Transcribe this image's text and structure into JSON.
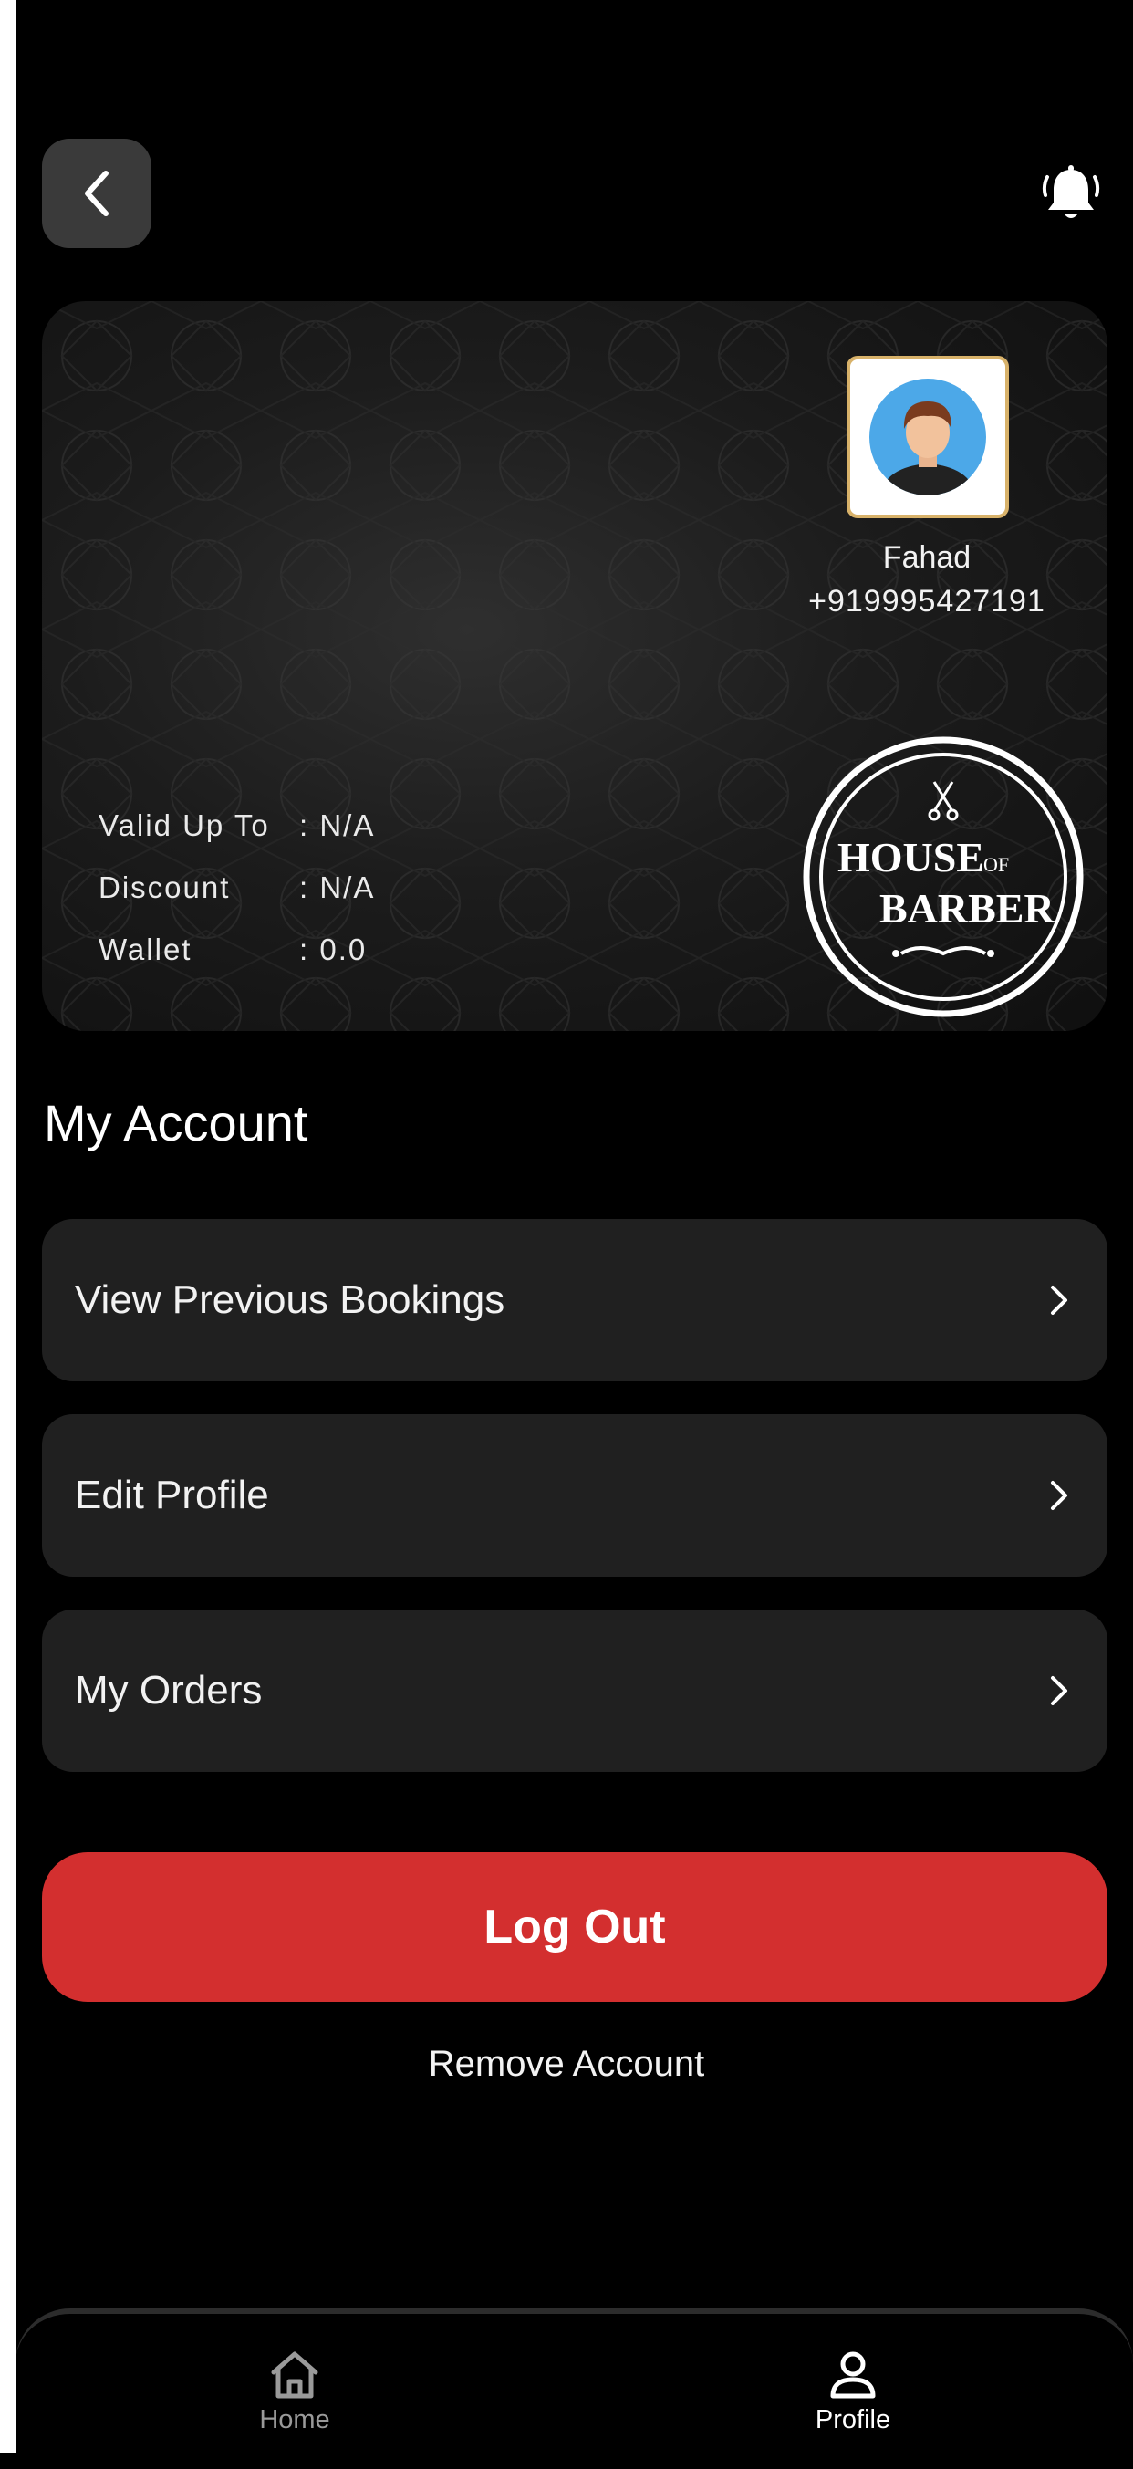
{
  "header": {
    "back_icon": "chevron-left-icon",
    "bell_icon": "bell-ring-icon"
  },
  "profile_card": {
    "name": "Fahad",
    "phone": "+919995427191",
    "avatar_icon": "user-avatar-icon",
    "valid_label": "Valid Up To",
    "valid_value": ": N/A",
    "discount_label": "Discount",
    "discount_value": ": N/A",
    "wallet_label": "Wallet",
    "wallet_value": ": 0.0",
    "logo": {
      "line1": "HOUSE",
      "of": "OF",
      "line2": "BARBER"
    }
  },
  "section_title": "My Account",
  "menu": [
    {
      "label": "View Previous Bookings"
    },
    {
      "label": "Edit Profile"
    },
    {
      "label": "My Orders"
    }
  ],
  "logout_label": "Log Out",
  "remove_label": "Remove Account",
  "bottom_nav": {
    "home": {
      "label": "Home",
      "icon": "home-icon",
      "active": false
    },
    "profile": {
      "label": "Profile",
      "icon": "person-icon",
      "active": true
    }
  },
  "colors": {
    "background": "#000000",
    "card_item": "#202020",
    "logout": "#d32f2f",
    "avatar_border": "#d8b26a"
  }
}
